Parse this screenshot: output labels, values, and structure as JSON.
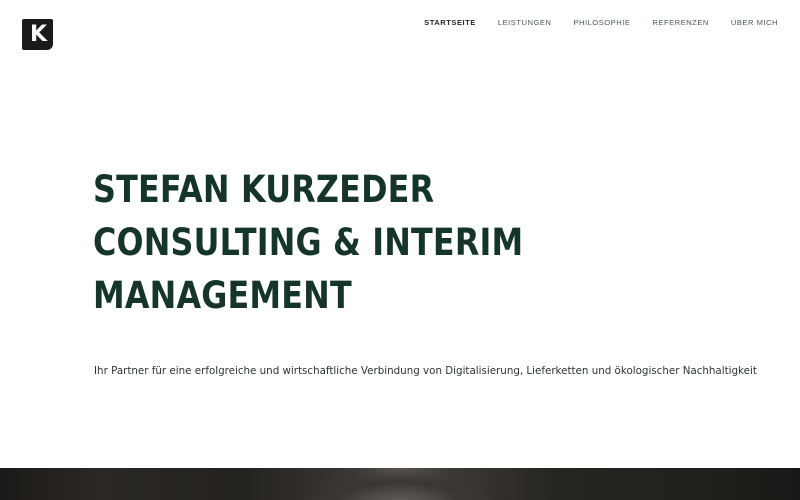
{
  "header": {
    "logo": {
      "letter": "K",
      "icon": "k-logo-icon"
    },
    "nav": [
      {
        "label": "STARTSEITE",
        "active": true
      },
      {
        "label": "LEISTUNGEN",
        "active": false
      },
      {
        "label": "PHILOSOPHIE",
        "active": false
      },
      {
        "label": "REFERENZEN",
        "active": false
      },
      {
        "label": "ÜBER MICH",
        "active": false
      }
    ]
  },
  "hero": {
    "title_lines": [
      "STEFAN KURZEDER",
      "CONSULTING & INTERIM",
      "MANAGEMENT"
    ],
    "subtitle": "Ihr Partner für eine erfolgreiche und wirtschaftliche Verbindung von Digitalisierung, Lieferketten und ökologischer Nachhaltigkeit"
  },
  "colors": {
    "primary_text": "#16352a",
    "nav_text": "#4a5a54",
    "logo_bg": "#1a1a1a",
    "background": "#ffffff"
  }
}
